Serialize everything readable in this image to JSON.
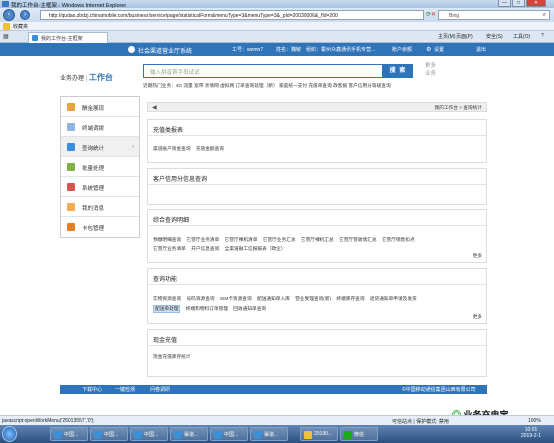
{
  "window": {
    "title": "我的工作台-主框架 - Windows Internet Explorer",
    "minimize": "—",
    "maximize": "□",
    "close": "✕"
  },
  "browser": {
    "url": "http://qudao.zbdzj.chinamobile.com/business!service/page/statisticalForm&menuType=3&menuType=3&_pId=20030006&_fId=200",
    "search_engine": "Bing",
    "favorites_label": "收藏夹",
    "tab_title": "我的工作台-主框架",
    "tools": [
      "主页(M)",
      "页面(P)",
      "安全(S)",
      "工具(O)",
      "?"
    ]
  },
  "header": {
    "system_name": "社会渠道营业厅系统",
    "user_label": "工号：wemn7",
    "name_label": "姓名：魏敏",
    "org_label": "组织：霍州众鑫通讯手机专营...",
    "account_menu": "账户余额",
    "settings": "设置",
    "logout": "退出"
  },
  "brand": {
    "prefix": "业务办理",
    "accent": "工作台"
  },
  "search": {
    "placeholder": "输入拼音首字母试试",
    "button": "搜 索",
    "biz_text": "更多业务"
  },
  "hot": "近期热门业务：4G  流量  宽带  亲情网  虚拟网  订单查询处理（新）  家庭统一支付  充值单查询  政客报  客户信用分等级查询",
  "sidebar": {
    "items": [
      {
        "label": "酬金展现",
        "color": "#e8a33d"
      },
      {
        "label": "终端调拨",
        "color": "#8fb3d9"
      },
      {
        "label": "查询统计",
        "color": "#3a8fd6",
        "arrow": "›"
      },
      {
        "label": "批量处理",
        "color": "#7cb342"
      },
      {
        "label": "系统管理",
        "color": "#d9534f"
      },
      {
        "label": "我的消息",
        "color": "#f0ad4e"
      },
      {
        "label": "卡包管理",
        "color": "#e67e22"
      }
    ]
  },
  "crumb": {
    "back": "◀",
    "path": "我的工作台 > 查询统计"
  },
  "panels": [
    {
      "title": "充值类报表",
      "links": [
        "渠道账户资金查询",
        "充值金额查询"
      ],
      "more": ""
    },
    {
      "title": "客户信用分信息查询",
      "links": [],
      "more": ""
    },
    {
      "title": "综合查询明细",
      "links": [
        "预缴明细查询",
        "它营厅业务清单",
        "它营厅裸机清单",
        "它营厅业务汇总",
        "它营厅裸机汇总",
        "它营厅营收情汇总",
        "它营厅销售扣点"
      ],
      "links2": [
        "它营厅业务清单",
        "开户信息查询",
        "全渠道融工信报报表（政企）"
      ],
      "more": "更多"
    },
    {
      "title": "查询功能",
      "links": [
        "实物资源查询",
        "号码资源查询",
        "SIM卡资源查询",
        "配送通知单入库",
        "营业受理查询(新)",
        "终端库存查询",
        "退货通知单申请及发货"
      ],
      "links2": [
        "配送单处理",
        "终端和物料订单管理",
        "回收通知单查询"
      ],
      "more": "更多"
    },
    {
      "title": "现金充值",
      "links": [
        "现金充值库存统计"
      ],
      "more": ""
    }
  ],
  "footer": {
    "links": [
      "下载中心",
      "一键检测",
      "问卷调研"
    ],
    "copy": "©中国移动通信集团山西有限公司"
  },
  "status": {
    "left": "javascript:openWorkMenu('25013557','0');",
    "zone": "可信站点 | 保护模式: 禁用",
    "zoom": "100%"
  },
  "taskbar": {
    "items": [
      "中国...",
      "中国...",
      "中国...",
      "渠道...",
      "中国...",
      "渠道...",
      "20190...",
      "微信"
    ],
    "time": "10:01",
    "date": "2019-2-1"
  },
  "watermark": "业务充电宝"
}
